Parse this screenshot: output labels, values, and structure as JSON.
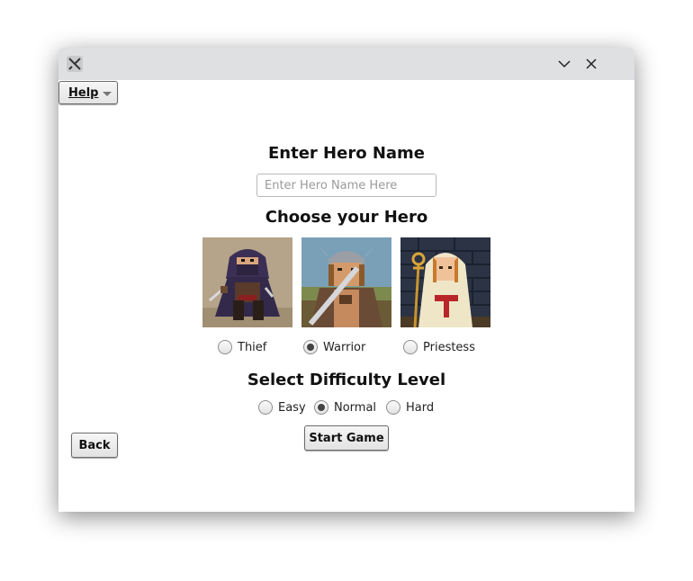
{
  "window": {
    "app_icon": "x-window-icon",
    "controls": [
      "minimize-chevron-icon",
      "close-icon"
    ]
  },
  "menu": {
    "help_label": "Help"
  },
  "hero_name": {
    "heading": "Enter Hero Name",
    "placeholder": "Enter Hero Name Here",
    "value": ""
  },
  "heroes": {
    "heading": "Choose your Hero",
    "options": [
      {
        "label": "Thief",
        "selected": false
      },
      {
        "label": "Warrior",
        "selected": true
      },
      {
        "label": "Priestess",
        "selected": false
      }
    ]
  },
  "difficulty": {
    "heading": "Select Difficulty Level",
    "options": [
      {
        "label": "Easy",
        "selected": false
      },
      {
        "label": "Normal",
        "selected": true
      },
      {
        "label": "Hard",
        "selected": false
      }
    ]
  },
  "buttons": {
    "back": "Back",
    "start": "Start Game"
  }
}
